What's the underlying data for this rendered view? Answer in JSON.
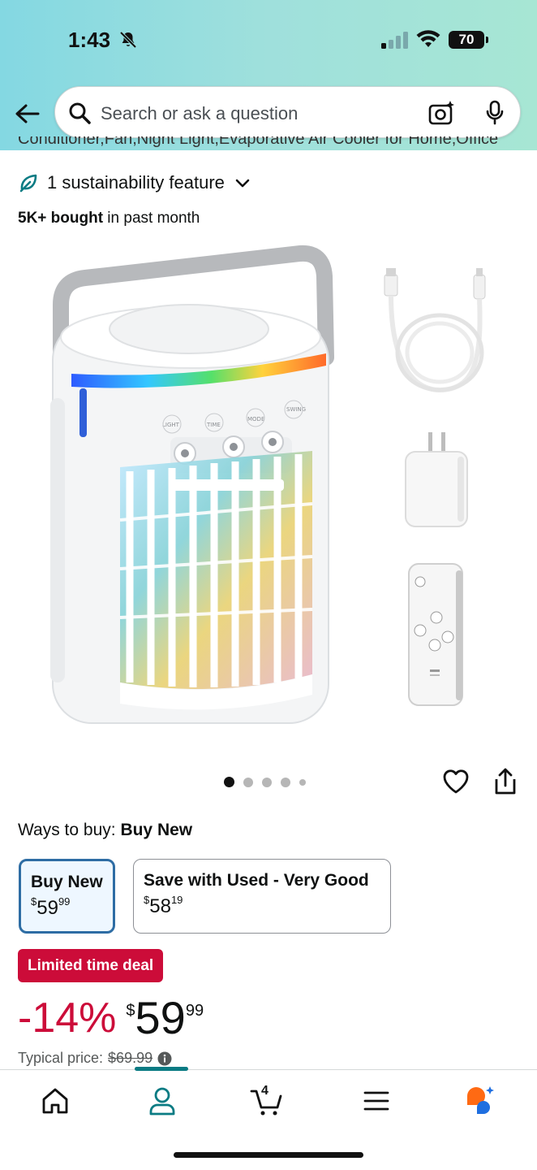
{
  "status": {
    "time": "1:43",
    "battery": "70"
  },
  "search": {
    "placeholder": "Search or ask a question"
  },
  "product": {
    "title_cut": "Conditioner,Fan,Night Light,Evaporative Air Cooler for Home,Office",
    "sustainability": "1 sustainability feature",
    "bought_bold": "5K+ bought",
    "bought_rest": " in past month"
  },
  "gallery": {
    "image_count": 5,
    "active_index": 0
  },
  "buy": {
    "ways_label": "Ways to buy: ",
    "ways_value": "Buy New",
    "options": [
      {
        "label": "Buy New",
        "currency": "$",
        "whole": "59",
        "fraction": "99"
      },
      {
        "label": "Save with Used - Very Good",
        "currency": "$",
        "whole": "58",
        "fraction": "19"
      }
    ],
    "deal_badge": "Limited time deal",
    "discount": "-14%",
    "price_currency": "$",
    "price_whole": "59",
    "price_fraction": "99",
    "typical_label": "Typical price: ",
    "typical_value": "$69.99"
  },
  "tabbar": {
    "cart_count": "4"
  },
  "colors": {
    "deal_red": "#cc0c39",
    "teal": "#0a7b83",
    "selected_border": "#2e6da4",
    "rufus_orange": "#ff6a13"
  }
}
